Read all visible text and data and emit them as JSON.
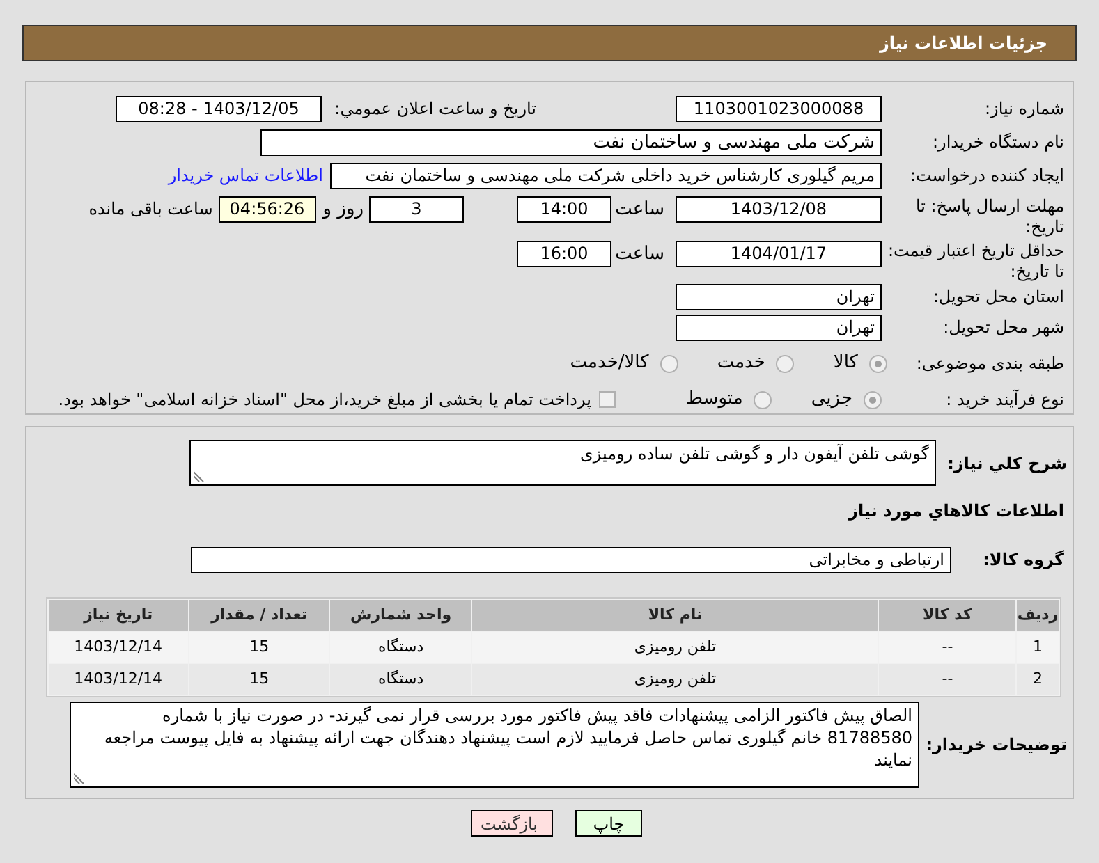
{
  "header": {
    "title": "جزئیات اطلاعات نیاز"
  },
  "need_number": {
    "label": "شماره نیاز:",
    "value": "1103001023000088"
  },
  "announce": {
    "label": "تاریخ و ساعت اعلان عمومي:",
    "value": "1403/12/05 - 08:28"
  },
  "buyer_org": {
    "label": "نام دستگاه خریدار:",
    "value": "شرکت ملی مهندسی و ساختمان نفت"
  },
  "requester": {
    "label": "ایجاد کننده درخواست:",
    "value": "مریم گیلوری کارشناس خرید داخلی شرکت ملی مهندسی و ساختمان نفت",
    "link": "اطلاعات تماس خریدار"
  },
  "deadline": {
    "label": "مهلت ارسال پاسخ: تا تاریخ:",
    "date": "1403/12/08",
    "time_label": "ساعت",
    "time": "14:00",
    "days": "3",
    "days_label": "روز و",
    "remaining": "04:56:26",
    "remaining_label": "ساعت باقی مانده"
  },
  "price_validity": {
    "label": "حداقل تاریخ اعتبار قیمت: تا تاریخ:",
    "date": "1404/01/17",
    "time_label": "ساعت",
    "time": "16:00"
  },
  "province": {
    "label": "استان محل تحویل:",
    "value": "تهران"
  },
  "city": {
    "label": "شهر محل تحویل:",
    "value": "تهران"
  },
  "category": {
    "label": "طبقه بندی موضوعی:",
    "options": [
      {
        "label": "کالا",
        "selected": true
      },
      {
        "label": "خدمت",
        "selected": false
      },
      {
        "label": "کالا/خدمت",
        "selected": false
      }
    ]
  },
  "process": {
    "label": "نوع فرآیند خرید :",
    "options": [
      {
        "label": "جزیی",
        "selected": true
      },
      {
        "label": "متوسط",
        "selected": false
      }
    ],
    "payment": {
      "label": "پرداخت تمام یا بخشی از مبلغ خرید،از محل \"اسناد خزانه اسلامی\" خواهد بود.",
      "checked": false
    }
  },
  "summary": {
    "label": "شرح کلي نياز:",
    "value": "گوشی تلفن آیفون دار و گوشی تلفن ساده رومیزی"
  },
  "goods_heading": "اطلاعات کالاهاي مورد نياز",
  "goods_group": {
    "label": "گروه کالا:",
    "value": "ارتباطی و مخابراتی"
  },
  "table": {
    "columns": [
      "ردیف",
      "کد کالا",
      "نام کالا",
      "واحد شمارش",
      "تعداد / مقدار",
      "تاریخ نیاز"
    ],
    "rows": [
      [
        "1",
        "--",
        "تلفن رومیزی",
        "دستگاه",
        "15",
        "1403/12/14"
      ],
      [
        "2",
        "--",
        "تلفن رومیزی",
        "دستگاه",
        "15",
        "1403/12/14"
      ]
    ]
  },
  "buyer_notes": {
    "label": "توضیحات خریدار:",
    "value": "الصاق پیش فاکتور الزامی پیشنهادات فاقد پیش فاکتور مورد بررسی قرار نمی گیرند- در صورت نیاز با شماره 81788580 خانم گیلوری تماس حاصل فرمایید لازم است پیشنهاد دهندگان جهت ارائه پیشنهاد به فایل پیوست مراجعه نمایند"
  },
  "buttons": [
    {
      "label": "چاپ",
      "kind": "print"
    },
    {
      "label": "بازگشت",
      "kind": "back"
    }
  ]
}
